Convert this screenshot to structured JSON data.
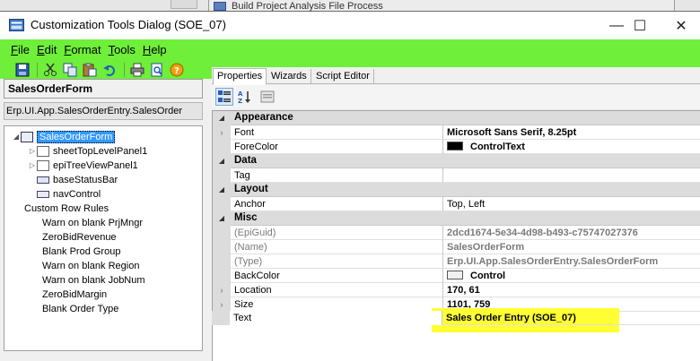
{
  "background": {
    "window_title": "Build Project Analysis File Process",
    "strip_text": "Process"
  },
  "titlebar": {
    "title": "Customization Tools Dialog  (SOE_07)",
    "minimize": "—",
    "maximize": "☐",
    "close": "✕"
  },
  "menu": {
    "items": [
      {
        "key": "F",
        "rest": "ile"
      },
      {
        "key": "E",
        "rest": "dit"
      },
      {
        "key": "F",
        "rest": "ormat"
      },
      {
        "key": "T",
        "rest": "ools"
      },
      {
        "key": "H",
        "rest": "elp"
      }
    ]
  },
  "toolbar": {
    "icons": [
      "save-icon",
      "cut-icon",
      "copy-icon",
      "paste-icon",
      "undo-icon",
      "print-icon",
      "print-preview-icon",
      "help-icon"
    ]
  },
  "left": {
    "form_title": "SalesOrderForm",
    "form_path": "Erp.UI.App.SalesOrderEntry.SalesOrder",
    "tree": [
      {
        "label": "SalesOrderForm"
      },
      {
        "label": "sheetTopLevelPanel1"
      },
      {
        "label": "epiTreeViewPanel1"
      },
      {
        "label": "baseStatusBar"
      },
      {
        "label": "navControl"
      },
      {
        "label": "Custom Row Rules"
      },
      {
        "label": "Warn on blank PrjMngr"
      },
      {
        "label": "ZeroBidRevenue"
      },
      {
        "label": "Blank Prod Group"
      },
      {
        "label": "Warn on blank Region"
      },
      {
        "label": "Warn on blank JobNum"
      },
      {
        "label": "ZeroBidMargin"
      },
      {
        "label": "Blank Order Type"
      }
    ]
  },
  "tabs": [
    {
      "label": "Properties"
    },
    {
      "label": "Wizards"
    },
    {
      "label": "Script Editor"
    }
  ],
  "properties": {
    "appearance": {
      "label": "Appearance"
    },
    "font": {
      "name": "Font",
      "value": "Microsoft Sans Serif, 8.25pt"
    },
    "forecolor": {
      "name": "ForeColor",
      "value": "ControlText",
      "color": "#000000"
    },
    "data": {
      "label": "Data"
    },
    "tag": {
      "name": "Tag",
      "value": ""
    },
    "layout": {
      "label": "Layout"
    },
    "anchor": {
      "name": "Anchor",
      "value": "Top, Left"
    },
    "misc": {
      "label": "Misc"
    },
    "epiguid": {
      "name": "(EpiGuid)",
      "value": "2dcd1674-5e34-4d98-b493-c75747027376"
    },
    "name_prop": {
      "name": "(Name)",
      "value": "SalesOrderForm"
    },
    "type_prop": {
      "name": "(Type)",
      "value": "Erp.UI.App.SalesOrderEntry.SalesOrderForm"
    },
    "backcolor": {
      "name": "BackColor",
      "value": "Control",
      "color": "#f0f0f0"
    },
    "location": {
      "name": "Location",
      "value": "170, 61"
    },
    "size": {
      "name": "Size",
      "value": "1101, 759"
    },
    "text": {
      "name": "Text",
      "value": "Sales Order Entry (SOE_07)"
    }
  },
  "colors": {
    "accent_green": "#6fee3a",
    "highlight_yellow": "#ffff33",
    "selection_blue": "#3399ff"
  }
}
